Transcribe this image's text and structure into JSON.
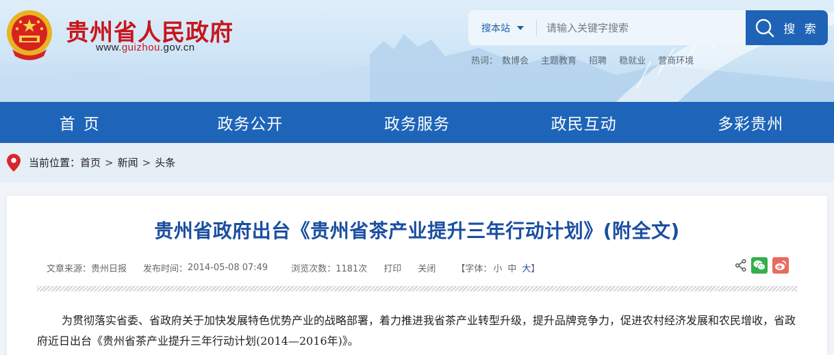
{
  "header": {
    "site_name": "贵州省人民政府",
    "url_prefix": "www.",
    "url_highlight": "guizhou",
    "url_suffix": ".gov.cn"
  },
  "search": {
    "scope_label": "搜本站",
    "placeholder": "请输入关键字搜索",
    "button_label": "搜 索"
  },
  "hotwords": {
    "label": "热词：",
    "items": [
      "数博会",
      "主题教育",
      "招聘",
      "稳就业",
      "营商环境"
    ]
  },
  "nav": {
    "items": [
      "首页",
      "政务公开",
      "政务服务",
      "政民互动",
      "多彩贵州"
    ]
  },
  "breadcrumb": {
    "label": "当前位置：",
    "items": [
      "首页",
      "新闻",
      "头条"
    ],
    "separator": ">"
  },
  "article": {
    "title": "贵州省政府出台《贵州省茶产业提升三年行动计划》(附全文)",
    "source_label": "文章来源：",
    "source": "贵州日报",
    "date_label": "发布时间：",
    "date": "2014-05-08 07:49",
    "views_label": "浏览次数：",
    "views": "1181次",
    "print_label": "打印",
    "close_label": "关闭",
    "font_open": "【字体：",
    "font_small": "小",
    "font_medium": "中",
    "font_large": "大",
    "font_close": "】",
    "body": "为贯彻落实省委、省政府关于加快发展特色优势产业的战略部署，着力推进我省茶产业转型升级，提升品牌竞争力，促进农村经济发展和农民增收，省政府近日出台《贵州省茶产业提升三年行动计划(2014—2016年)》。"
  },
  "colors": {
    "brand_red": "#c8161d",
    "nav_blue": "#1e64b9",
    "title_blue": "#1a4ea0",
    "wechat_green": "#33b04a",
    "weibo_red": "#e86b5f"
  },
  "icons": [
    "national-emblem-icon",
    "search-icon",
    "location-pin-icon",
    "share-icon",
    "wechat-icon",
    "weibo-icon",
    "caret-down-icon"
  ]
}
